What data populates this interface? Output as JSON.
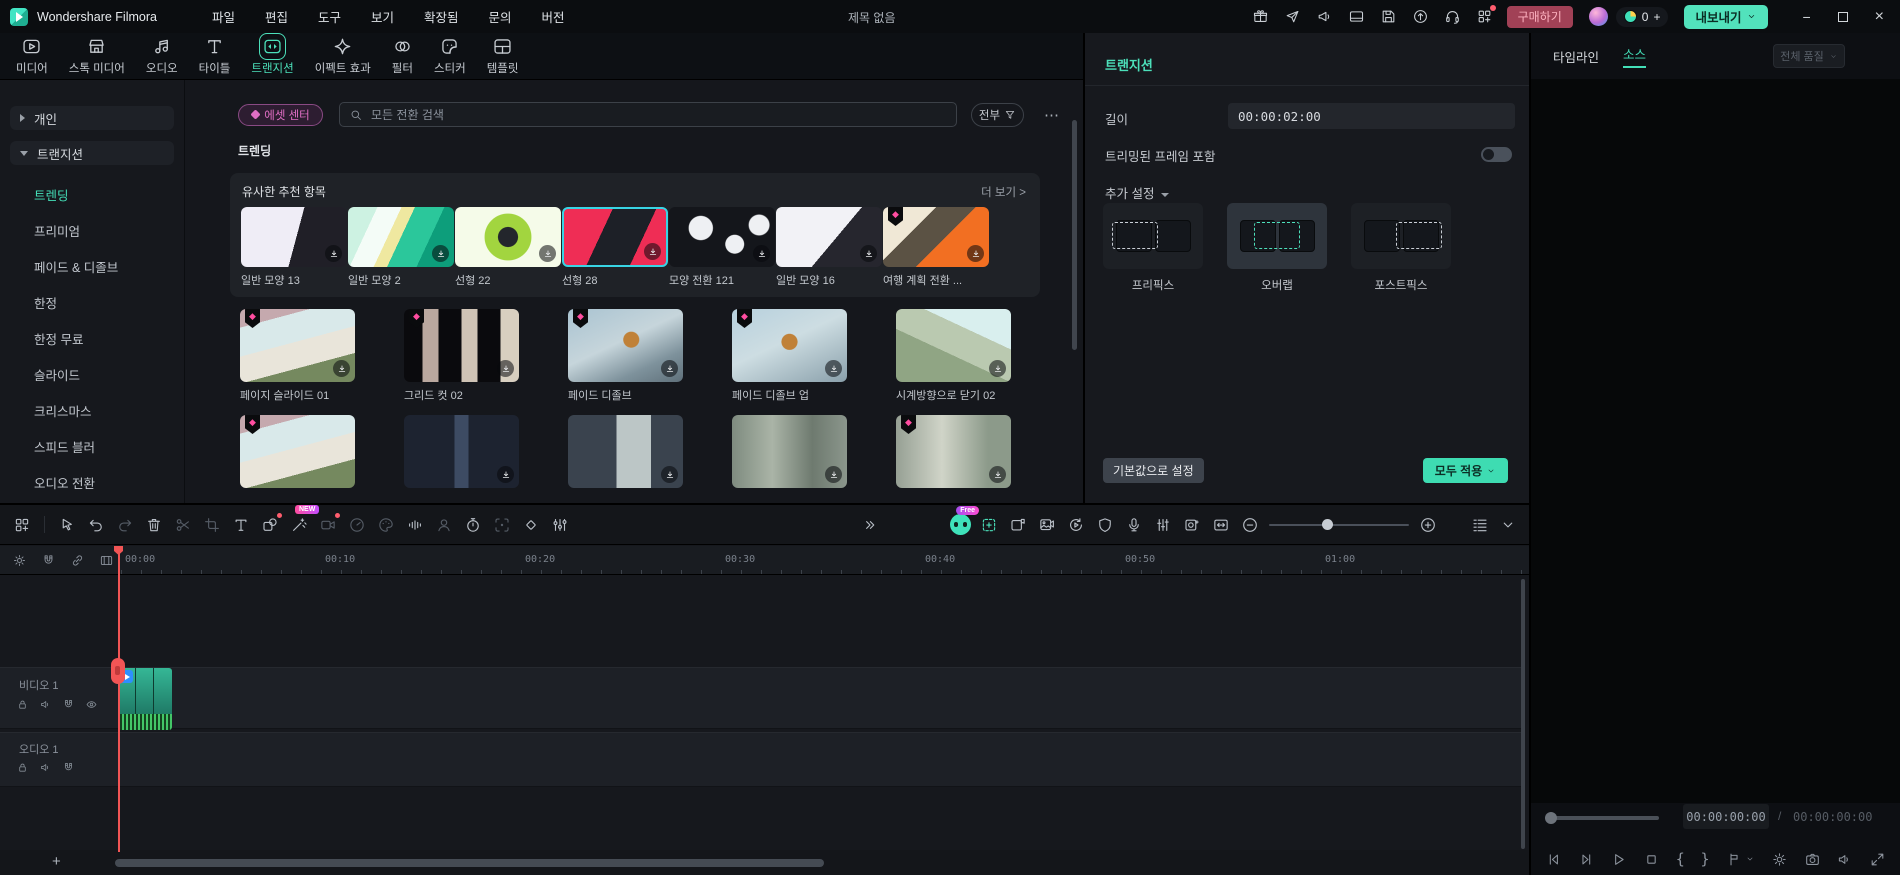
{
  "titlebar": {
    "app_name": "Wondershare Filmora",
    "menus": [
      "파일",
      "편집",
      "도구",
      "보기",
      "확장됨",
      "문의",
      "버전"
    ],
    "document_title": "제목 없음",
    "icon_names": [
      "gift-icon",
      "promotion-icon",
      "megaphone-icon",
      "workspace-icon",
      "save-icon",
      "update-icon",
      "support-icon",
      "apps-icon"
    ],
    "purchase_label": "구매하기",
    "coin_count": "0",
    "coin_add": "+",
    "export_label": "내보내기"
  },
  "media_tabs": {
    "items": [
      "미디어",
      "스톡 미디어",
      "오디오",
      "타이틀",
      "트랜지션",
      "이펙트 효과",
      "필터",
      "스티커",
      "템플릿"
    ],
    "active": "트랜지션"
  },
  "sidebar": {
    "personal": "개인",
    "group": "트랜지션",
    "items": [
      "트렌딩",
      "프리미엄",
      "페이드 & 디졸브",
      "한정",
      "한정 무료",
      "슬라이드",
      "크리스마스",
      "스피드 블러",
      "오디오 전환"
    ],
    "active": "트렌딩"
  },
  "browser": {
    "asset_center": "에셋 센터",
    "search_placeholder": "모든 전환 검색",
    "filter_all": "전부",
    "section": "트렌딩",
    "recommended": {
      "title": "유사한 추천 항목",
      "more": "더 보기 >",
      "items": [
        {
          "name": "일반 모양 13",
          "pro": false,
          "bg": "linear-gradient(105deg,#efedf6 52%,#201f27 52%)"
        },
        {
          "name": "일반 모양 2",
          "pro": false,
          "bg": "linear-gradient(115deg,#cdf2e2 22%,#f4fcf7 22% 40%,#efe8a0 40% 50%,#2bc79b 50% 72%,#0d9e7b 72%)"
        },
        {
          "name": "선형 22",
          "pro": false,
          "bg": "radial-gradient(circle at 50% 50%,#23262c 16%,#a2d53f 17% 38%,#f5fbe9 39%)"
        },
        {
          "name": "선형 28",
          "pro": false,
          "selected": true,
          "bg": "linear-gradient(115deg,#ef2d55 38%,#1d2027 38% 72%,#ef2d55 72%)"
        },
        {
          "name": "모양 전환 121",
          "pro": false,
          "bg": "radial-gradient(circle at 30% 35%,#eef0f3 14%,rgba(0,0,0,0) 15%),radial-gradient(circle at 62% 62%,#eef0f3 12%,rgba(0,0,0,0) 13%),radial-gradient(circle at 85% 30%,#eef0f3 10%,#14161b 11%)"
        },
        {
          "name": "일반 모양 16",
          "pro": false,
          "bg": "linear-gradient(130deg,#f2f2f6 55%,#26262e 55%)"
        },
        {
          "name": "여행 계획 전환 ...",
          "pro": true,
          "bg": "linear-gradient(135deg,#f0e8d6 32%,#5b5244 32% 56%,#f26f22 56%)"
        }
      ]
    },
    "grid": [
      {
        "name": "페이지 슬라이드 01",
        "pro": true,
        "bg": "linear-gradient(165deg,#c5a9ae 18%,#d9e9ea 18% 46%,#e9e5da 46% 72%,#75895f 72%)"
      },
      {
        "name": "그리드 컷 02",
        "pro": true,
        "bg": "linear-gradient(90deg,#0a0a0d 16%,#baa89f 16% 30%,#0a0a0d 30% 50%,#cfc3b5 50% 64%,#0a0a0d 64% 84%,#d8cfc0 84%)"
      },
      {
        "name": "페이드 디졸브",
        "pro": true,
        "bg": "radial-gradient(circle at 55% 42%,#c08138 10%,rgba(0,0,0,0) 11%),linear-gradient(155deg,#a9c3d1 0%,#c6d5db 45%,#7e929c 75%,#5f707a 100%)"
      },
      {
        "name": "페이드 디졸브 업",
        "pro": true,
        "bg": "radial-gradient(circle at 50% 45%,#c08138 11%,rgba(0,0,0,0) 12%),linear-gradient(155deg,#b7d0dd 0%,#cddde2 45%,#8aa0ab 100%)"
      },
      {
        "name": "시계방향으로 닫기 02",
        "pro": false,
        "bg": "linear-gradient(205deg,#d9efee 32%,#bac9b0 32% 58%,#90a584 58%)"
      }
    ],
    "grid_partial": [
      {
        "pro": true,
        "bg": "linear-gradient(165deg,#c5a9ae 18%,#d9e9ea 18% 46%,#e9e5da 46% 72%,#75895f 72%)"
      },
      {
        "pro": false,
        "bg": "linear-gradient(90deg,#1d2330 44%,#3d4b63 44% 56%,#1d2330 56%)"
      },
      {
        "pro": false,
        "bg": "linear-gradient(90deg,#3a434e 42%,#bcc6c6 42% 72%,#3a434e 72%)"
      },
      {
        "pro": false,
        "bg": "linear-gradient(90deg,#7e8b7f 0%,#aab4a7 35%,#6e7a6f 70%,#8b968c 100%)"
      },
      {
        "pro": true,
        "bg": "linear-gradient(90deg,#96a094 0%,#d0d4c8 40%,#8c9a8a 80%)"
      }
    ]
  },
  "inspector": {
    "title": "트랜지션",
    "duration_label": "길이",
    "duration_value": "00:00:02:00",
    "trimmed_label": "트리밍된 프레임 포함",
    "trimmed_on": false,
    "advanced_label": "추가 설정",
    "modes": [
      "프리픽스",
      "오버랩",
      "포스트픽스"
    ],
    "active_mode": "오버랩",
    "reset_label": "기본값으로 설정",
    "apply_label": "모두 적용"
  },
  "preview": {
    "tabs": [
      "타임라인",
      "소스"
    ],
    "active_tab": "소스",
    "quality": "전체 품질",
    "current_time": "00:00:00:00",
    "total_time": "00:00:00:00"
  },
  "timeline": {
    "ruler": [
      "00:00",
      "00:10",
      "00:20",
      "00:30",
      "00:40",
      "00:50",
      "01:00"
    ],
    "video_track": "비디오 1",
    "audio_track": "오디오 1",
    "new_badge": "NEW",
    "free_badge": "Free",
    "toolbar_left_icons": [
      "layout-grid-icon",
      "select-tool-icon",
      "undo-icon",
      "redo-icon",
      "delete-icon",
      "split-icon",
      "crop-icon",
      "text-tool-icon",
      "mask-icon",
      "smart-cut-icon",
      "screen-record-icon",
      "speed-icon",
      "color-match-icon",
      "audio-stretch-icon",
      "portrait-cutout-icon",
      "timer-icon",
      "motion-track-icon",
      "keyframe-icon",
      "adjust-icon",
      "more-tools-icon"
    ],
    "toolbar_right_icons": [
      "ai-copilot-icon",
      "smart-reframe-icon",
      "export-clip-icon",
      "media-export-icon",
      "render-preview-icon",
      "safe-zone-icon",
      "voiceover-icon",
      "audio-mixer-icon",
      "snapshot-icon",
      "auto-ripple-icon",
      "zoom-out-icon",
      "zoom-slider",
      "zoom-in-icon",
      "track-height-icon"
    ]
  },
  "colors": {
    "accent": "#4ce0ba",
    "purchase_bg": "#a14156",
    "purchase_text": "#ffb3c1",
    "pro_badge": "#ff4da0",
    "playhead": "#f25555"
  }
}
